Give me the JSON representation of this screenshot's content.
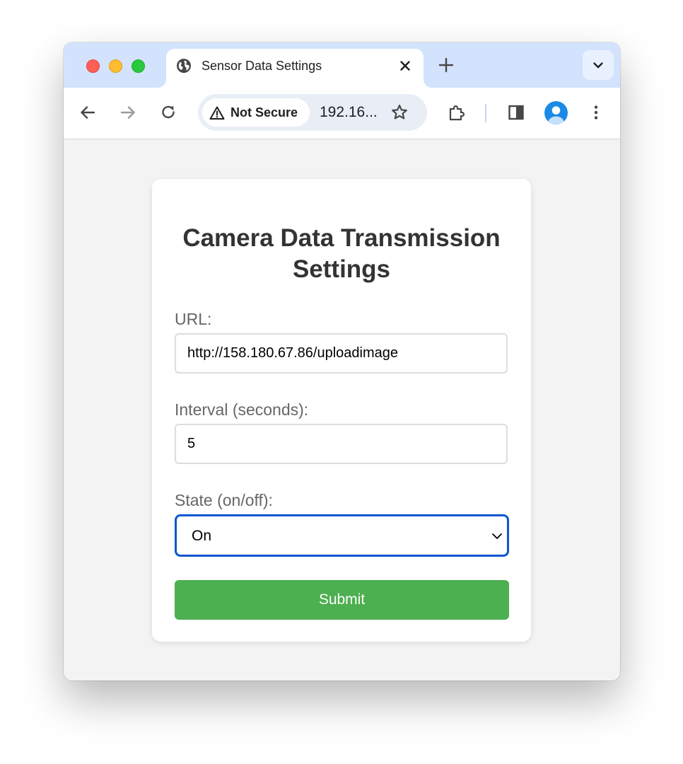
{
  "browser": {
    "tab": {
      "title": "Sensor Data Settings",
      "favicon": "globe-icon"
    },
    "toolbar": {
      "security_label": "Not Secure",
      "url_display": "192.16...",
      "icons": [
        "back-arrow-icon",
        "forward-arrow-icon",
        "reload-icon",
        "warning-icon",
        "star-icon",
        "extensions-icon",
        "side-panel-icon",
        "profile-avatar-icon",
        "more-menu-icon"
      ]
    }
  },
  "form": {
    "title": "Camera Data Transmission Settings",
    "url_label": "URL:",
    "url_value": "http://158.180.67.86/uploadimage",
    "interval_label": "Interval (seconds):",
    "interval_value": "5",
    "state_label": "State (on/off):",
    "state_value": "On",
    "submit_label": "Submit"
  },
  "colors": {
    "tabstrip": "#d3e3fd",
    "submit_button": "#4caf50",
    "select_focus_border": "#0b57d0",
    "title_text": "#333333",
    "label_text": "#666666"
  }
}
